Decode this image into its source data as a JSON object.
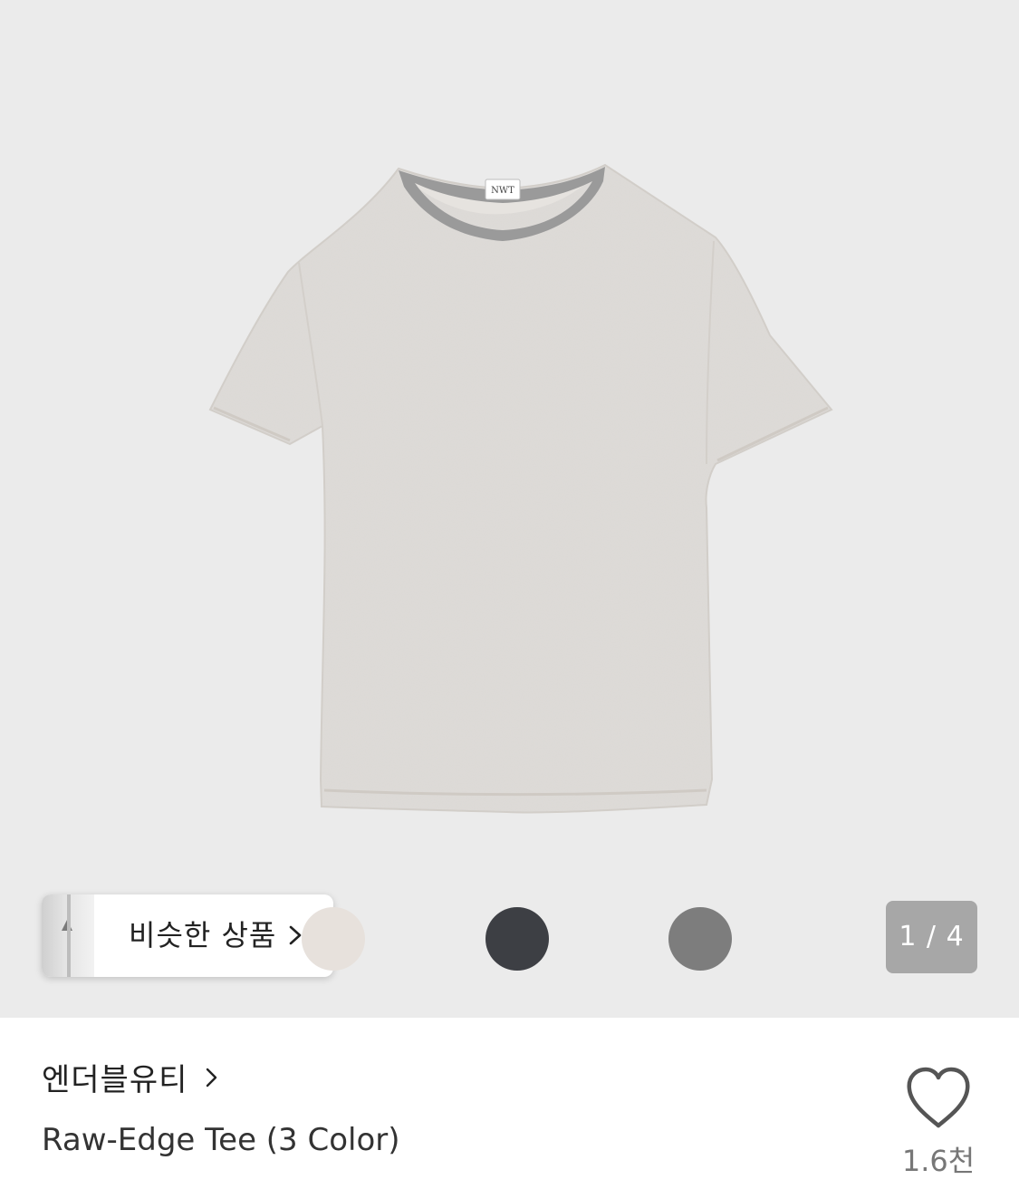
{
  "product_gallery": {
    "similar_label": "비슷한 상품",
    "color_swatches": [
      {
        "name": "oatmeal",
        "color": "#e7e1dc"
      },
      {
        "name": "charcoal",
        "color": "#3d3f44"
      },
      {
        "name": "gray",
        "color": "#7d7d7d"
      }
    ],
    "pager_text": "1 / 4",
    "collar_label": "NWT"
  },
  "product_info": {
    "brand": "엔더블유티",
    "title": "Raw-Edge Tee (3 Color)",
    "like_count": "1.6천"
  },
  "colors": {
    "background": "#ebebeb",
    "shirt": "#dedbd8",
    "collar": "#9a9a9a",
    "text_primary": "#222222",
    "text_secondary": "#777777"
  }
}
